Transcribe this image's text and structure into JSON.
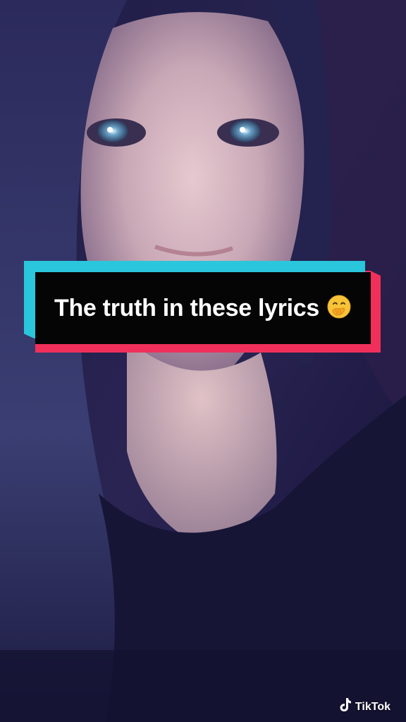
{
  "caption": {
    "text": "The truth in these lyrics",
    "emoji": "hand-over-mouth-icon"
  },
  "watermark": {
    "brand": "TikTok",
    "icon": "tiktok-logo-icon"
  },
  "colors": {
    "caption_cyan": "#29c6dc",
    "caption_red": "#f0305a",
    "caption_bg": "#050505",
    "caption_text": "#ffffff"
  }
}
